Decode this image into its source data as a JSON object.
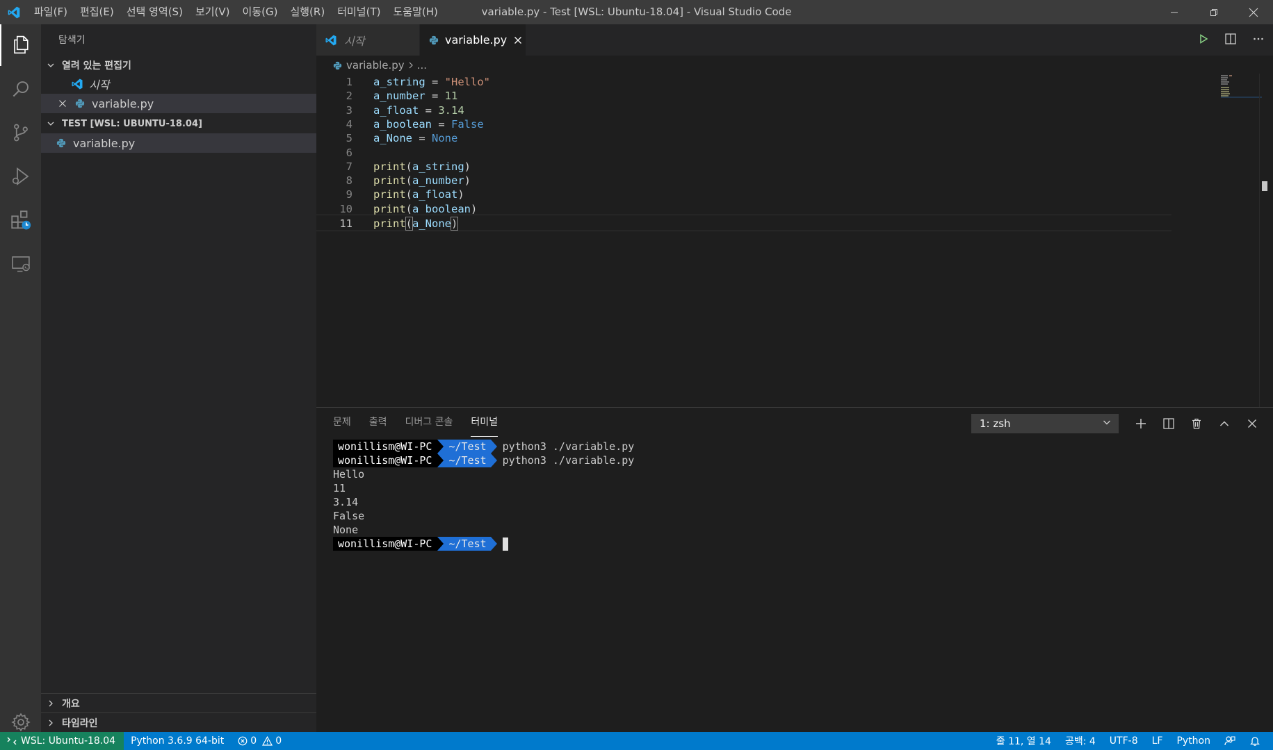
{
  "window": {
    "title": "variable.py - Test [WSL: Ubuntu-18.04] - Visual Studio Code",
    "menu": [
      "파일(F)",
      "편집(E)",
      "선택 영역(S)",
      "보기(V)",
      "이동(G)",
      "실행(R)",
      "터미널(T)",
      "도움말(H)"
    ]
  },
  "sidebar": {
    "title": "탐색기",
    "open_editors": {
      "header": "열려 있는 편집기",
      "items": [
        {
          "label": "시작",
          "icon": "vscode-logo-icon"
        },
        {
          "label": "variable.py",
          "icon": "python-file-icon"
        }
      ]
    },
    "workspace": {
      "header": "TEST [WSL: UBUNTU-18.04]",
      "items": [
        {
          "label": "variable.py",
          "icon": "python-file-icon"
        }
      ]
    },
    "outline_header": "개요",
    "timeline_header": "타임라인"
  },
  "editor": {
    "tabs": [
      {
        "label": "시작",
        "active": false
      },
      {
        "label": "variable.py",
        "active": true
      }
    ],
    "breadcrumb": {
      "file": "variable.py",
      "rest": "..."
    },
    "line_numbers": [
      "1",
      "2",
      "3",
      "4",
      "5",
      "6",
      "7",
      "8",
      "9",
      "10",
      "11"
    ],
    "lines": [
      [
        {
          "t": "a_string",
          "c": "var"
        },
        {
          "t": " = ",
          "c": "plain"
        },
        {
          "t": "\"Hello\"",
          "c": "str"
        }
      ],
      [
        {
          "t": "a_number",
          "c": "var"
        },
        {
          "t": " = ",
          "c": "plain"
        },
        {
          "t": "11",
          "c": "num"
        }
      ],
      [
        {
          "t": "a_float",
          "c": "var"
        },
        {
          "t": " = ",
          "c": "plain"
        },
        {
          "t": "3.14",
          "c": "num"
        }
      ],
      [
        {
          "t": "a_boolean",
          "c": "var"
        },
        {
          "t": " = ",
          "c": "plain"
        },
        {
          "t": "False",
          "c": "kw"
        }
      ],
      [
        {
          "t": "a_None",
          "c": "var"
        },
        {
          "t": " = ",
          "c": "plain"
        },
        {
          "t": "None",
          "c": "kw"
        }
      ],
      [],
      [
        {
          "t": "print",
          "c": "fn"
        },
        {
          "t": "(",
          "c": "plain"
        },
        {
          "t": "a_string",
          "c": "var"
        },
        {
          "t": ")",
          "c": "plain"
        }
      ],
      [
        {
          "t": "print",
          "c": "fn"
        },
        {
          "t": "(",
          "c": "plain"
        },
        {
          "t": "a_number",
          "c": "var"
        },
        {
          "t": ")",
          "c": "plain"
        }
      ],
      [
        {
          "t": "print",
          "c": "fn"
        },
        {
          "t": "(",
          "c": "plain"
        },
        {
          "t": "a_float",
          "c": "var"
        },
        {
          "t": ")",
          "c": "plain"
        }
      ],
      [
        {
          "t": "print",
          "c": "fn"
        },
        {
          "t": "(",
          "c": "plain"
        },
        {
          "t": "a_boolean",
          "c": "var"
        },
        {
          "t": ")",
          "c": "plain"
        }
      ],
      [
        {
          "t": "print",
          "c": "fn"
        },
        {
          "t": "(",
          "c": "plain",
          "hl": true
        },
        {
          "t": "a_None",
          "c": "var"
        },
        {
          "t": ")",
          "c": "plain",
          "hl": true
        }
      ]
    ],
    "current_line": 11
  },
  "panel": {
    "tabs": [
      "문제",
      "출력",
      "디버그 콘솔",
      "터미널"
    ],
    "active_tab": "터미널",
    "terminal_selector": "1: zsh",
    "terminal": {
      "user": "wonillism@WI-PC",
      "dir": "~/Test",
      "commands": [
        "python3 ./variable.py",
        "python3 ./variable.py"
      ],
      "output": [
        "Hello",
        "11",
        "3.14",
        "False",
        "None"
      ]
    }
  },
  "statusbar": {
    "remote": "WSL: Ubuntu-18.04",
    "interpreter": "Python 3.6.9 64-bit",
    "errors": "0",
    "warnings": "0",
    "position": "줄 11, 열 14",
    "spaces": "공백: 4",
    "encoding": "UTF-8",
    "eol": "LF",
    "language": "Python"
  },
  "colors": {
    "accent": "#007acc",
    "remote": "#16825d",
    "terminal_dir_bg": "#1f6fd6"
  }
}
